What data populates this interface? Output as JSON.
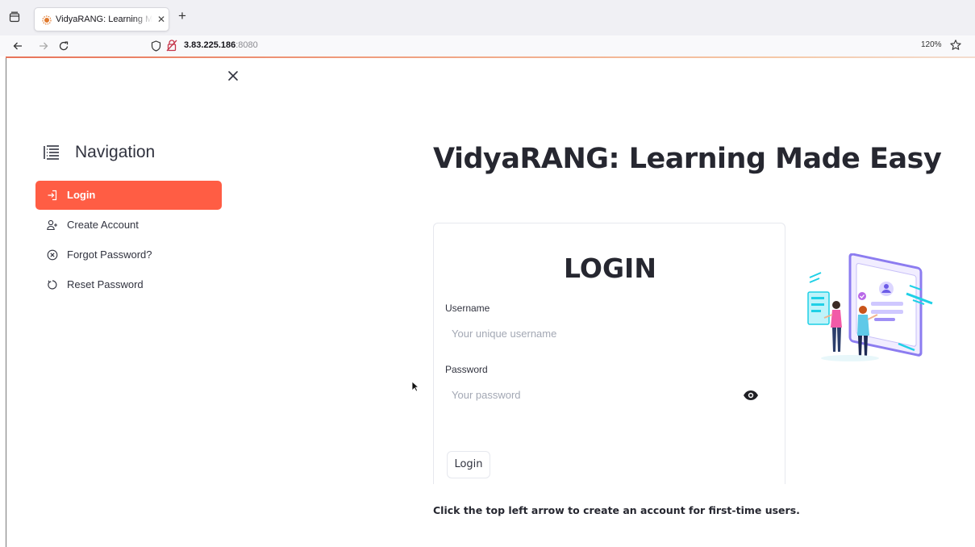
{
  "browser": {
    "tab_title": "VidyaRANG: Learning Made Easy",
    "url_host": "3.83.225.186",
    "url_port": ":8080",
    "zoom_level": "120%",
    "icons": [
      "tab-list-icon",
      "favicon-icon",
      "close-icon",
      "plus-icon",
      "back-arrow-icon",
      "forward-arrow-icon",
      "reload-icon",
      "shield-icon",
      "lock-warning-icon",
      "star-icon"
    ]
  },
  "sidebar": {
    "title": "Navigation",
    "items": [
      {
        "label": "Login",
        "icon": "login-icon",
        "active": true
      },
      {
        "label": "Create Account",
        "icon": "person-add-icon",
        "active": false
      },
      {
        "label": "Forgot Password?",
        "icon": "x-circle-icon",
        "active": false
      },
      {
        "label": "Reset Password",
        "icon": "reset-icon",
        "active": false
      }
    ],
    "active_color": "#ff5d44"
  },
  "main": {
    "title": "VidyaRANG: Learning Made Easy",
    "form": {
      "heading": "LOGIN",
      "username_label": "Username",
      "username_placeholder": "Your unique username",
      "password_label": "Password",
      "password_placeholder": "Your password",
      "submit_label": "Login"
    },
    "hint": "Click the top left arrow to create an account for first-time users."
  }
}
